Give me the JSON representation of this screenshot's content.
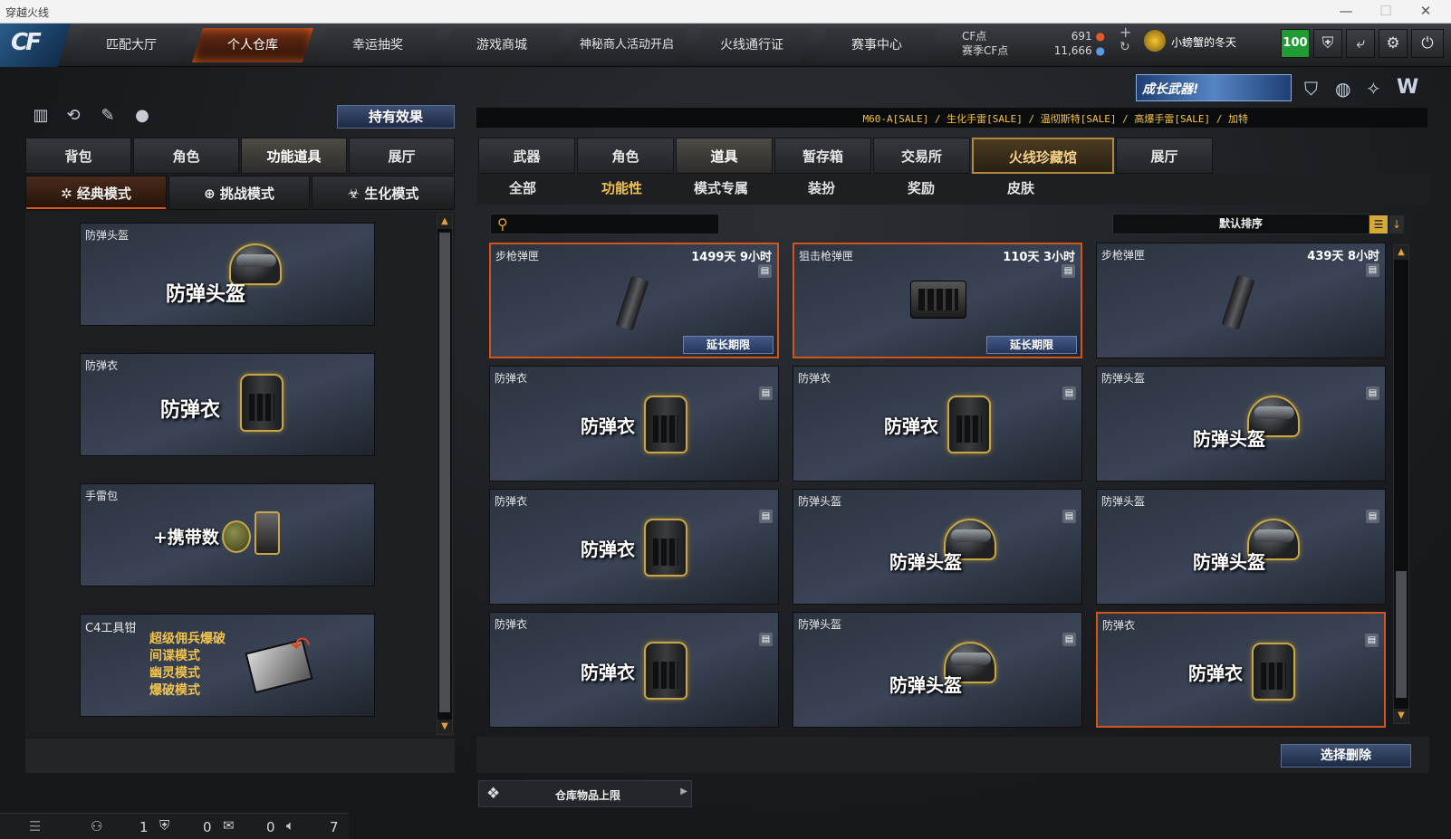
{
  "window": {
    "title": "穿越火线",
    "minimize": "—",
    "maximize": "☐",
    "close": "✕"
  },
  "nav": {
    "logo": "CF",
    "tabs": [
      "匹配大厅",
      "个人仓库",
      "幸运抽奖",
      "游戏商城",
      "神秘商人活动开启",
      "火线通行证",
      "赛事中心"
    ],
    "active_tab": "个人仓库"
  },
  "currency": {
    "cf_label": "CF点",
    "cf_value": "691",
    "season_label": "赛季CF点",
    "season_value": "11,666"
  },
  "user": {
    "name": "小螃蟹的冬天",
    "level": "100"
  },
  "banner": {
    "text": "成长武器!"
  },
  "ticker": "M60-A[SALE] / 生化手雷[SALE] / 温彻斯特[SALE] / 高爆手雷[SALE] / 加特",
  "left": {
    "effects_button": "持有效果",
    "tabs": [
      "背包",
      "角色",
      "功能道具",
      "展厅"
    ],
    "active_tab": "功能道具",
    "modes": [
      "经典模式",
      "挑战模式",
      "生化模式"
    ],
    "active_mode": "经典模式",
    "slots": [
      {
        "name": "防弹头盔",
        "caption": "防弹头盔"
      },
      {
        "name": "防弹衣",
        "caption": "防弹衣"
      },
      {
        "name": "手雷包",
        "caption": "+携带数"
      },
      {
        "name": "C4工具钳",
        "lines": [
          "超级佣兵爆破",
          "间谍模式",
          "幽灵模式",
          "爆破模式"
        ]
      }
    ]
  },
  "right": {
    "tabs": [
      "武器",
      "角色",
      "道具",
      "暂存箱",
      "交易所",
      "火线珍藏馆",
      "展厅"
    ],
    "active_tab": "道具",
    "subtabs": [
      "全部",
      "功能性",
      "模式专属",
      "装扮",
      "奖励",
      "皮肤"
    ],
    "active_subtab": "功能性",
    "search_placeholder": "",
    "sort_label": "默认排序",
    "items": [
      {
        "name": "步枪弹匣",
        "time": "1499天 9小时",
        "extend": "延长期限",
        "icon": "magazine"
      },
      {
        "name": "狙击枪弹匣",
        "time": "110天 3小时",
        "extend": "延长期限",
        "icon": "sniper-magazine"
      },
      {
        "name": "步枪弹匣",
        "time": "439天 8小时",
        "icon": "magazine"
      },
      {
        "name": "防弹衣",
        "caption": "防弹衣",
        "icon": "vest"
      },
      {
        "name": "防弹衣",
        "caption": "防弹衣",
        "icon": "vest"
      },
      {
        "name": "防弹头盔",
        "caption": "防弹头盔",
        "icon": "helmet"
      },
      {
        "name": "防弹衣",
        "caption": "防弹衣",
        "icon": "vest"
      },
      {
        "name": "防弹头盔",
        "caption": "防弹头盔",
        "icon": "helmet"
      },
      {
        "name": "防弹头盔",
        "caption": "防弹头盔",
        "icon": "helmet"
      },
      {
        "name": "防弹衣",
        "caption": "防弹衣",
        "icon": "vest"
      },
      {
        "name": "防弹头盔",
        "caption": "防弹头盔",
        "icon": "helmet"
      },
      {
        "name": "防弹衣",
        "caption": "防弹衣",
        "icon": "vest"
      }
    ],
    "delete_button": "选择删除",
    "storage_limit": "仓库物品上限"
  },
  "status": {
    "friends": "1",
    "clan": "0",
    "chat": "0",
    "voice": "7"
  },
  "colors": {
    "accent": "#d2561c",
    "gold": "#f3c24b",
    "level_bg": "#1f9d34"
  }
}
